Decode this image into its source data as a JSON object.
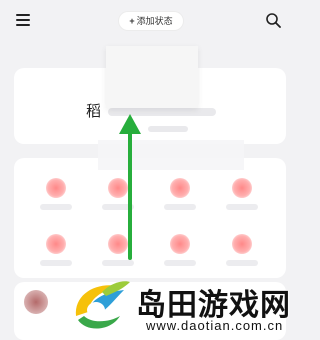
{
  "header": {
    "add_status_label": "添加状态",
    "add_status_plus": "+"
  },
  "card": {
    "title": "稻"
  },
  "icons": {
    "menu": "hamburger-menu-icon",
    "search": "search-icon",
    "arrow": "up-arrow-icon"
  },
  "watermark": {
    "title": "岛田游戏网",
    "url": "www.daotian.com.cn"
  },
  "colors": {
    "background": "#f2f2f4",
    "arrow": "#27ae3c",
    "accent_dot": "#ff6b6b"
  }
}
